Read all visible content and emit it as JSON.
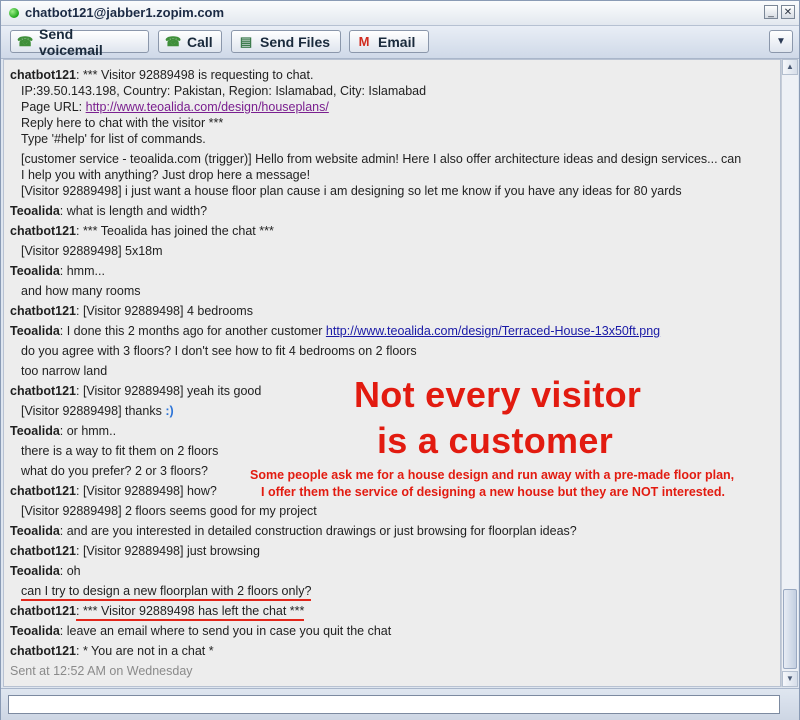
{
  "window": {
    "title": "chatbot121@jabber1.zopim.com",
    "minimize_label": "_",
    "close_label": "✕",
    "status_color": "#1ea51a"
  },
  "toolbar": {
    "voicemail_label": "Send voicemail",
    "call_label": "Call",
    "files_label": "Send Files",
    "email_label": "Email",
    "menu_label": "▼",
    "voicemail_icon": "phone-icon",
    "call_icon": "phone-icon",
    "files_icon": "files-icon",
    "email_icon": "gmail-icon"
  },
  "chat": {
    "l1_speaker": "chatbot121",
    "l1_text": ": *** Visitor 92889498 is requesting to chat.",
    "l2_text": "IP:39.50.143.198, Country: Pakistan, Region: Islamabad, City: Islamabad",
    "l3_prefix": "Page URL: ",
    "l3_link": "http://www.teoalida.com/design/houseplans/",
    "l4_text": "Reply here to chat with the visitor ***",
    "l5_text": "Type '#help' for list of commands.",
    "l6_text": "[customer service - teoalida.com (trigger)] Hello from website admin! Here I also offer architecture ideas and design services... can",
    "l7_text": "I help you with anything? Just drop here a message!",
    "l8_text": "[Visitor 92889498] i just want a house floor plan cause i am designing so let me know if you have any ideas for 80 yards",
    "l9_speaker": "Teoalida",
    "l9_text": ": what is length and width?",
    "l10_speaker": "chatbot121",
    "l10_text": ": *** Teoalida has joined the chat ***",
    "l11_text": "[Visitor 92889498] 5x18m",
    "l12_speaker": "Teoalida",
    "l12_text": ": hmm...",
    "l13_text": "and how many rooms",
    "l14_speaker": "chatbot121",
    "l14_text": ": [Visitor 92889498] 4 bedrooms",
    "l15_speaker": "Teoalida",
    "l15_text": ": I done this 2 months ago for another customer ",
    "l15_link": "http://www.teoalida.com/design/Terraced-House-13x50ft.png",
    "l16_text": "do you agree with 3 floors? I don't see how to fit 4 bedrooms on 2 floors",
    "l17_text": "too narrow land",
    "l18_speaker": "chatbot121",
    "l18_text": ": [Visitor 92889498] yeah its good",
    "l19_text": "[Visitor 92889498] thanks ",
    "l19_smiley": ":)",
    "l20_speaker": "Teoalida",
    "l20_text": ": or hmm..",
    "l21_text": "there is a way to fit them on 2 floors",
    "l22_text": "what do you prefer? 2 or 3 floors?",
    "l23_speaker": "chatbot121",
    "l23_text": ": [Visitor 92889498] how?",
    "l24_text": "[Visitor 92889498] 2 floors seems good for my project",
    "l25_speaker": "Teoalida",
    "l25_text": ": and are you interested in detailed construction drawings or just browsing for floorplan ideas?",
    "l26_speaker": "chatbot121",
    "l26_text": ": [Visitor 92889498] just browsing",
    "l27_speaker": "Teoalida",
    "l27_text": ": oh",
    "l28_text": "can I try to design a new floorplan with 2 floors only?",
    "l29_speaker": "chatbot121",
    "l29_text": ": *** Visitor 92889498 has left the chat ***",
    "l30_speaker": "Teoalida",
    "l30_text": ": leave an email where to send you in case you quit the chat",
    "l31_speaker": "chatbot121",
    "l31_text": ": * You are not in a chat *",
    "sent": "Sent at 12:52 AM on Wednesday"
  },
  "annotation": {
    "big_line1": "Not every visitor",
    "big_line2": "is a customer",
    "small_line1": "Some people ask me for a house design and run away with a pre-made floor plan,",
    "small_line2": "I offer them the service of designing a new house but they are NOT interested.",
    "color": "#e21b10"
  },
  "input": {
    "value": ""
  }
}
